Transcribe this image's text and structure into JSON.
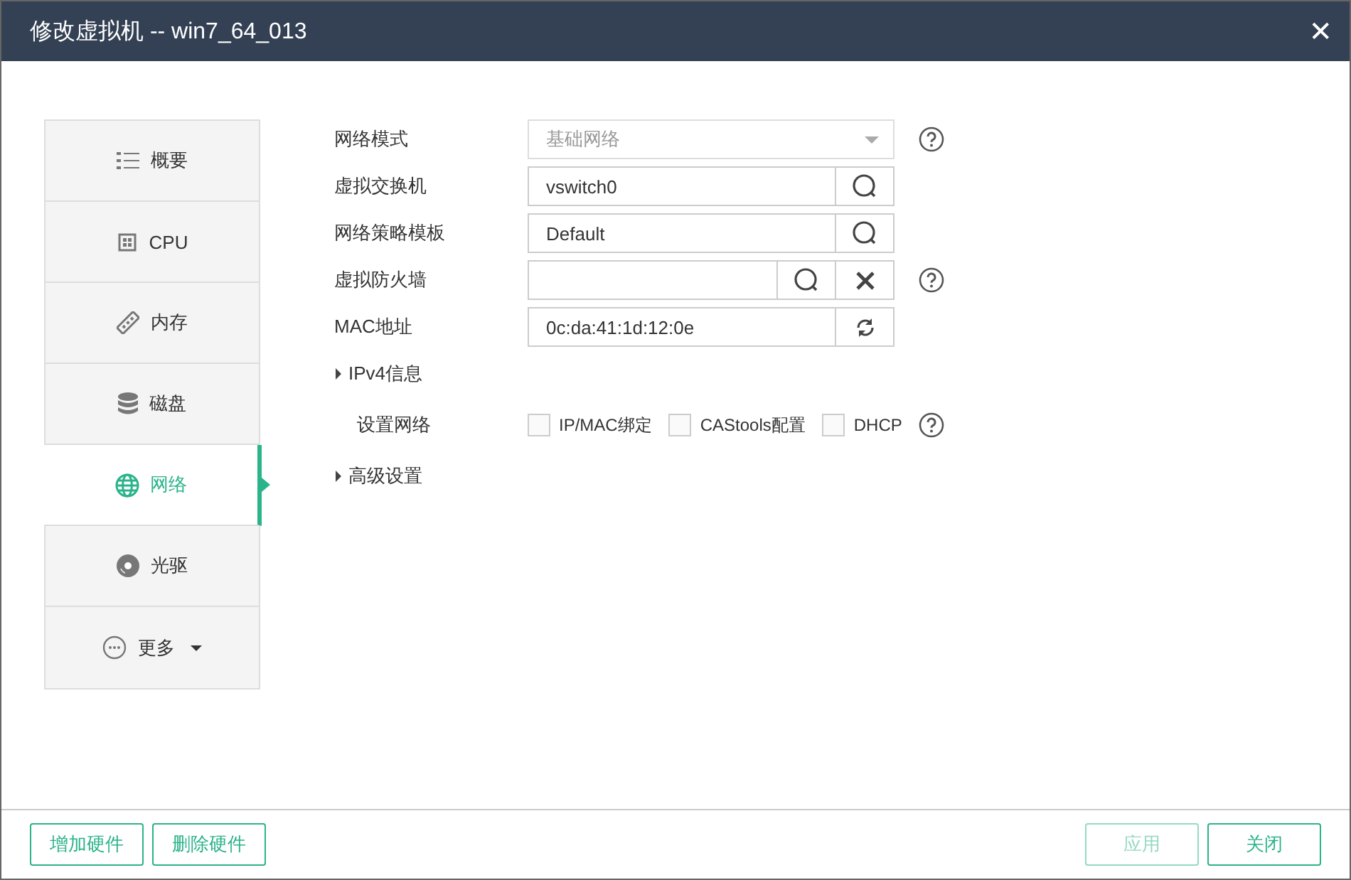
{
  "window": {
    "title": "修改虚拟机 -- win7_64_013",
    "close": "✕"
  },
  "sidebar": {
    "items": [
      {
        "label": "概要",
        "kind": "list",
        "selected": false
      },
      {
        "label": "CPU",
        "kind": "chip",
        "selected": false
      },
      {
        "label": "内存",
        "kind": "memory",
        "selected": false
      },
      {
        "label": "磁盘",
        "kind": "disk",
        "selected": false
      },
      {
        "label": "网络",
        "kind": "globe",
        "selected": true
      },
      {
        "label": "光驱",
        "kind": "cd",
        "selected": false
      },
      {
        "label": "更多",
        "kind": "more",
        "selected": false,
        "dropdown": true
      }
    ]
  },
  "form": {
    "fields": [
      {
        "label": "网络模式",
        "kind": "select",
        "value": "基础网络",
        "disabled": true,
        "help": true
      },
      {
        "label": "虚拟交换机",
        "kind": "search",
        "value": "vswitch0",
        "help": false
      },
      {
        "label": "网络策略模板",
        "kind": "search",
        "value": "Default",
        "help": false
      },
      {
        "label": "虚拟防火墙",
        "kind": "search-clear",
        "help": true
      },
      {
        "label": "MAC地址",
        "kind": "refresh",
        "value": "0c:da:41:1d:12:0e",
        "help": false
      }
    ],
    "ipv4": {
      "label": "IPv4信息",
      "expanded": false
    },
    "network_setup": {
      "label": "设置网络",
      "options": [
        {
          "label": "IP/MAC绑定",
          "checked": false
        },
        {
          "label": "CAStools配置",
          "checked": false
        },
        {
          "label": "DHCP",
          "checked": false
        }
      ],
      "help": true
    },
    "advanced": {
      "label": "高级设置",
      "expanded": false
    }
  },
  "footer": {
    "left_buttons": [
      {
        "label": "增加硬件",
        "disabled": false
      },
      {
        "label": "删除硬件",
        "disabled": false
      }
    ],
    "right_buttons": [
      {
        "label": "应用",
        "disabled": true
      },
      {
        "label": "关闭",
        "disabled": false
      }
    ]
  }
}
